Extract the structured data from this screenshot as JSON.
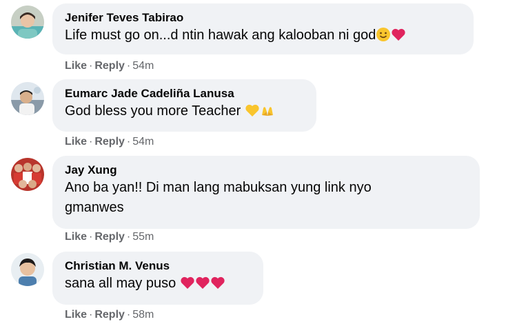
{
  "comments": [
    {
      "author": "Jenifer Teves Tabirao",
      "lines": [
        "Life must go on...d ntin hawak ang kalooban ni god"
      ],
      "emojis": [
        "smiling-face-icon",
        "red-heart-icon"
      ],
      "like": "Like",
      "reply": "Reply",
      "time": "54m"
    },
    {
      "author": "Eumarc Jade Cadeliña Lanusa",
      "lines": [
        "God bless you more Teacher"
      ],
      "emojis": [
        "yellow-heart-icon",
        "raising-hands-icon"
      ],
      "like": "Like",
      "reply": "Reply",
      "time": "54m"
    },
    {
      "author": "Jay Xung",
      "lines": [
        "Ano ba yan!! Di man lang mabuksan yung link nyo",
        "gmanwes"
      ],
      "emojis": [],
      "like": "Like",
      "reply": "Reply",
      "time": "55m"
    },
    {
      "author": "Christian M. Venus",
      "lines": [
        "sana all may puso"
      ],
      "emojis": [
        "red-heart-icon",
        "red-heart-icon",
        "red-heart-icon"
      ],
      "like": "Like",
      "reply": "Reply",
      "time": "58m"
    }
  ],
  "separator": "·",
  "colors": {
    "bubble": "#f0f2f5",
    "meta_text": "#65676b",
    "heart": "#e0245e",
    "yellow": "#f9c52d"
  }
}
